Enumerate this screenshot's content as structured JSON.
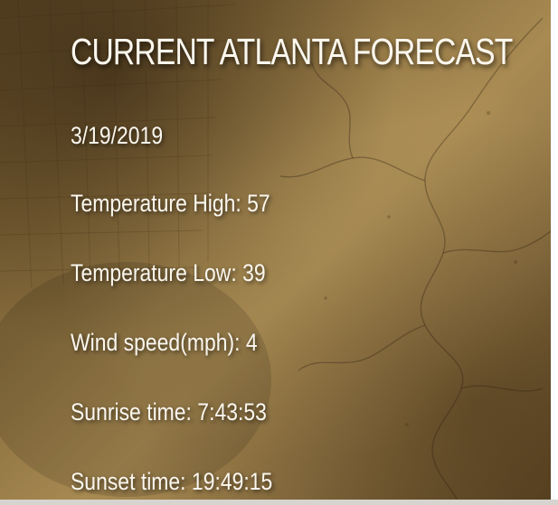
{
  "forecast": {
    "title": "CURRENT ATLANTA FORECAST",
    "date": "3/19/2019",
    "temp_high": "Temperature High: 57",
    "temp_low": "Temperature Low: 39",
    "wind_speed": "Wind speed(mph): 4",
    "sunrise": "Sunrise time: 7:43:53",
    "sunset": "Sunset time: 19:49:15"
  },
  "colors": {
    "text": "#fbf7ee",
    "parchment_light": "#a88a52",
    "parchment_dark": "#5f4a26"
  },
  "background": {
    "image": "antique-map-texture"
  }
}
